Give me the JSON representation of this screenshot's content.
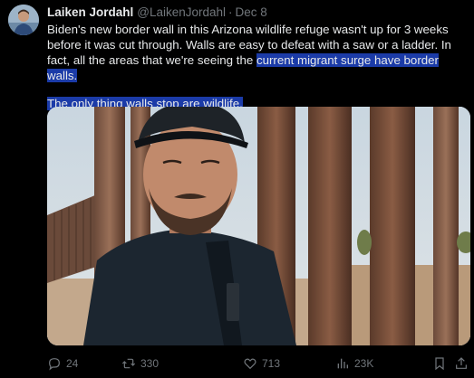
{
  "tweet": {
    "author_name": "Laiken Jordahl",
    "author_handle": "@LaikenJordahl",
    "separator": "·",
    "date": "Dec 8",
    "text_part1": "Biden's new border wall in this Arizona wildlife refuge wasn't up for 3 weeks before it was cut through. Walls are easy to defeat with a saw or a ladder. In fact, all the areas that we're seeing the ",
    "text_highlight1": "current migrant surge have border walls.",
    "text_highlight2": "The only thing walls stop are wildlife."
  },
  "actions": {
    "replies": "24",
    "reposts": "330",
    "likes": "713",
    "views": "23K"
  },
  "icons": [
    "reply-icon",
    "repost-icon",
    "like-icon",
    "views-icon",
    "bookmark-icon",
    "share-icon"
  ],
  "colors": {
    "background": "#000000",
    "text": "#e7e9ea",
    "muted": "#71767b",
    "highlight": "#1b3ba8"
  }
}
